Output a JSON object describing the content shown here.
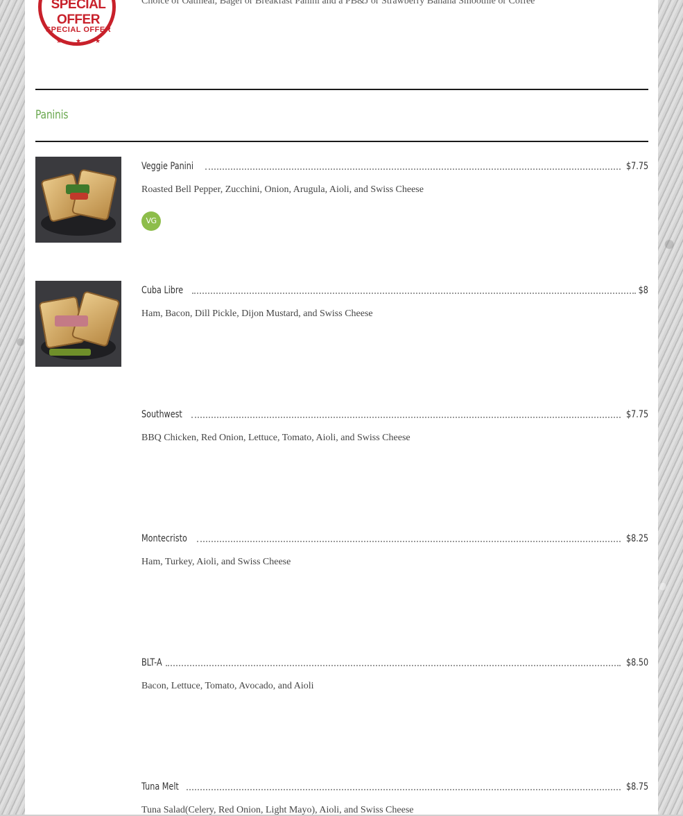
{
  "special_offer": {
    "badge_text_large": "SPECIAL OFFER",
    "badge_text_small": "SPECIAL OFFER",
    "description": "Choice of Oatmeal, Bagel or Breakfast Panini and a PB&J or Strawberry Banana Smoothie or Coffee"
  },
  "section": {
    "title": "Paninis"
  },
  "items": [
    {
      "name": "Veggie Panini",
      "price": "$7.75",
      "description": "Roasted Bell Pepper, Zucchini, Onion, Arugula, Aioli, and Swiss Cheese",
      "badge": "VG"
    },
    {
      "name": "Cuba Libre",
      "price": "$8",
      "description": "Ham, Bacon, Dill Pickle, Dijon Mustard, and Swiss Cheese"
    },
    {
      "name": "Southwest",
      "price": "$7.75",
      "description": "BBQ Chicken, Red Onion, Lettuce, Tomato, Aioli, and Swiss Cheese"
    },
    {
      "name": "Montecristo",
      "price": "$8.25",
      "description": "Ham, Turkey, Aioli, and Swiss Cheese"
    },
    {
      "name": "BLT-A",
      "price": "$8.50",
      "description": "Bacon, Lettuce, Tomato, Avocado, and Aioli"
    },
    {
      "name": "Tuna Melt",
      "price": "$8.75",
      "description": "Tuna Salad(Celery, Red Onion, Light Mayo), Aioli, and Swiss Cheese"
    }
  ],
  "colors": {
    "section_title": "#6aa84f",
    "badge_bg": "#8dbd4a",
    "offer_red": "#c8202a"
  }
}
